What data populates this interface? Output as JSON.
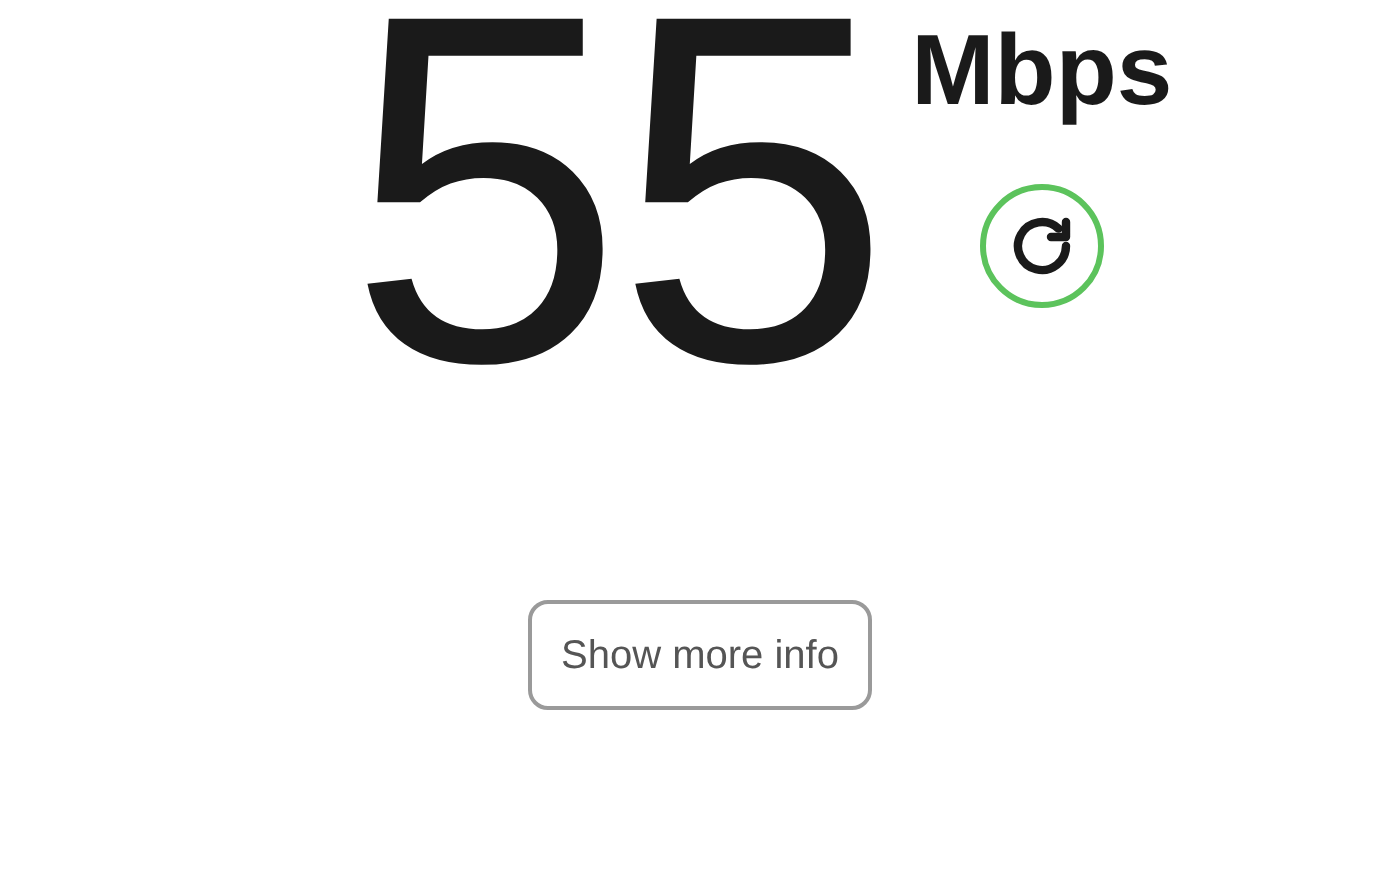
{
  "speed": {
    "value": "55",
    "unit": "Mbps"
  },
  "button": {
    "label": "Show more info"
  }
}
